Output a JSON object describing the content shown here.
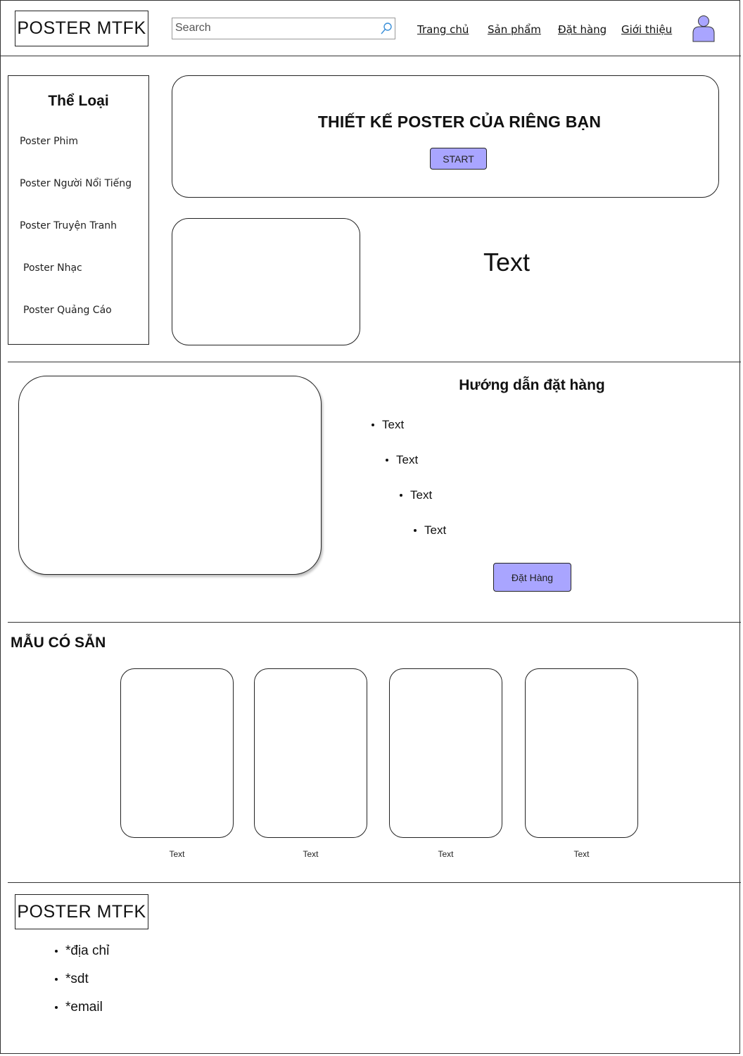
{
  "header": {
    "logo": "POSTER MTFK",
    "search_placeholder": "Search",
    "nav": [
      "Trang chủ",
      "Sản phẩm",
      "Đặt hàng",
      "Giới thiệu"
    ]
  },
  "sidebar": {
    "title": "Thể Loại",
    "items": [
      "Poster Phim",
      "Poster Người Nổi Tiếng",
      "Poster Truyện Tranh",
      "Poster Nhạc",
      "Poster Quảng Cáo"
    ]
  },
  "hero": {
    "title": "THIẾT KẾ POSTER CỦA RIÊNG BẠN",
    "button": "START"
  },
  "feature": {
    "text": "Text"
  },
  "guide": {
    "title": "Hướng dẫn đặt hàng",
    "items": [
      "Text",
      "Text",
      "Text",
      "Text"
    ],
    "button": "Đặt Hàng"
  },
  "templates": {
    "title": "MẪU CÓ SẴN",
    "captions": [
      "Text",
      "Text",
      "Text",
      "Text"
    ]
  },
  "footer": {
    "logo": "POSTER MTFK",
    "items": [
      "*địa chỉ",
      "*sdt",
      "*email"
    ]
  },
  "colors": {
    "accent": "#a9a5ff",
    "border": "#222222"
  },
  "icons": {
    "search": "search-icon",
    "user": "user-avatar-icon"
  }
}
